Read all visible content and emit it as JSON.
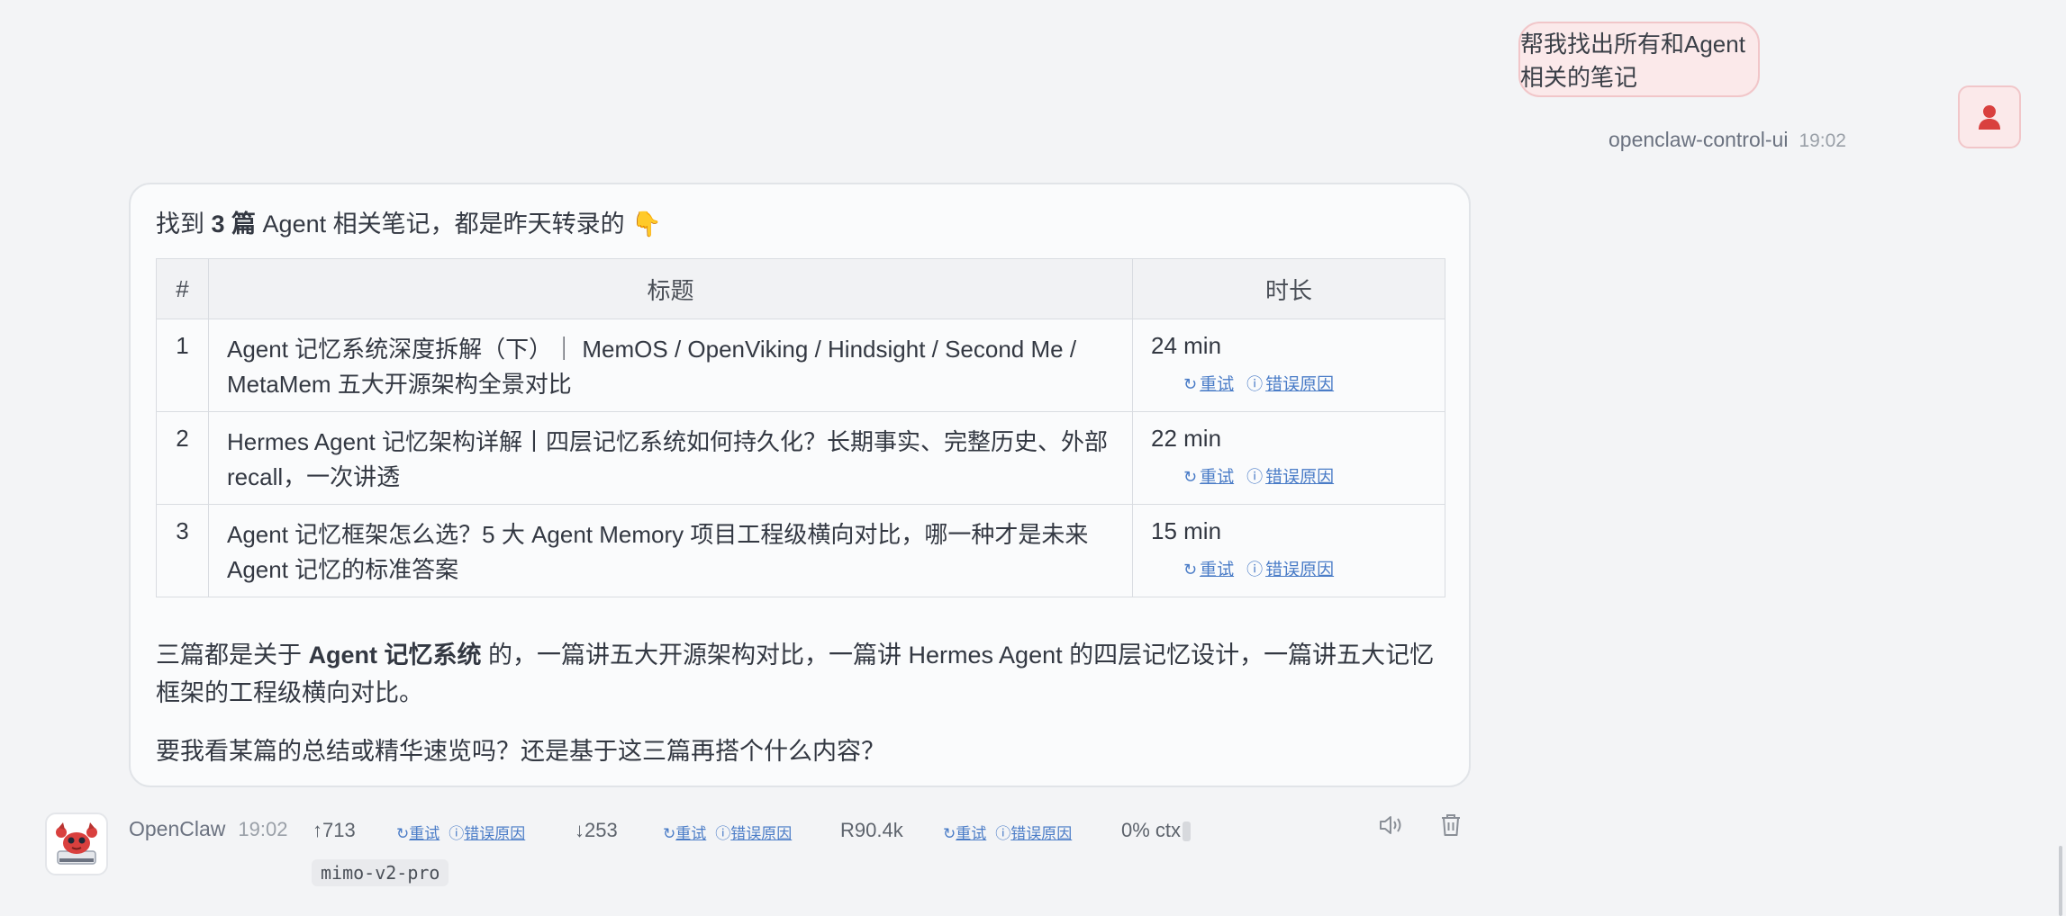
{
  "user_message": {
    "text": "帮我找出所有和Agent相关的笔记",
    "sender": "openclaw-control-ui",
    "time": "19:02"
  },
  "assistant": {
    "intro_prefix": "找到 ",
    "intro_bold": "3 篇",
    "intro_suffix": " Agent 相关笔记，都是昨天转录的 👇",
    "table": {
      "headers": [
        "#",
        "标题",
        "时长"
      ],
      "rows": [
        {
          "num": "1",
          "title": "Agent 记忆系统深度拆解（下）｜ MemOS / OpenViking / Hindsight / Second Me / MetaMem 五大开源架构全景对比",
          "duration": "24 min"
        },
        {
          "num": "2",
          "title": "Hermes Agent 记忆架构详解丨四层记忆系统如何持久化？长期事实、完整历史、外部 recall，一次讲透",
          "duration": "22 min"
        },
        {
          "num": "3",
          "title": "Agent 记忆框架怎么选？5 大 Agent Memory 项目工程级横向对比，哪一种才是未来 Agent 记忆的标准答案",
          "duration": "15 min"
        }
      ],
      "retry_label": "重试",
      "error_label": "错误原因"
    },
    "summary_prefix": "三篇都是关于 ",
    "summary_bold": "Agent 记忆系统",
    "summary_suffix": " 的，一篇讲五大开源架构对比，一篇讲 Hermes Agent 的四层记忆设计，一篇讲五大记忆框架的工程级横向对比。",
    "question": "要我看某篇的总结或精华速览吗？还是基于这三篇再搭个什么内容？"
  },
  "footer": {
    "bot_name": "OpenClaw",
    "time": "19:02",
    "tokens_up": "↑713",
    "tokens_down": "↓253",
    "cache_read": "R90.4k",
    "context": "0% ctx",
    "retry_label": "重试",
    "error_label": "错误原因",
    "model": "mimo-v2-pro"
  },
  "colors": {
    "accent_pink": "#fbe9ea",
    "avatar_red": "#d9403e",
    "link_blue": "#4a7cc7"
  }
}
